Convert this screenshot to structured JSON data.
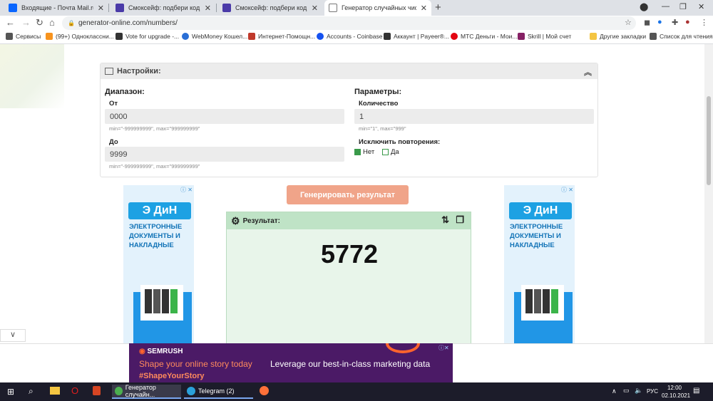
{
  "browser": {
    "tabs": [
      {
        "title": "Входящие - Почта Mail.ru",
        "color": "#0a66ff"
      },
      {
        "title": "Смокcейф: подбери код и полу",
        "color": "#4a3aa8"
      },
      {
        "title": "Смокcейф: подбери код и полу",
        "color": "#4a3aa8"
      },
      {
        "title": "Генератор случайных чисел он",
        "color": "#777777"
      }
    ],
    "new_tab": "+",
    "url": "generator-online.com/numbers/"
  },
  "bookmarks": [
    {
      "label": "Сервисы",
      "color": "#555555"
    },
    {
      "label": "(99+) Одноклассни...",
      "color": "#f7931e"
    },
    {
      "label": "Vote for upgrade -...",
      "color": "#333333"
    },
    {
      "label": "WebMoney Кошел...",
      "color": "#2a6fd6"
    },
    {
      "label": "Интернет-Помощн...",
      "color": "#c0392b"
    },
    {
      "label": "Accounts - Coinbase",
      "color": "#1652f0"
    },
    {
      "label": "Аккаунт | Payeer®...",
      "color": "#333333"
    },
    {
      "label": "МТС Деньги - Мои...",
      "color": "#e30611"
    },
    {
      "label": "Skrill | Мой счет",
      "color": "#862165"
    },
    {
      "label": "Другие закладки",
      "color": "#f4c542"
    },
    {
      "label": "Список для чтения",
      "color": "#555555"
    }
  ],
  "settings": {
    "title": "Настройки:",
    "range_label": "Диапазон:",
    "from_label": "От",
    "from_value": "0000",
    "from_hint": "min=\"-999999999\", max=\"999999999\"",
    "to_label": "До",
    "to_value": "9999",
    "to_hint": "min=\"-999999999\", max=\"999999999\"",
    "params_label": "Параметры:",
    "count_label": "Количество",
    "count_value": "1",
    "count_hint": "min=\"1\", max=\"999\"",
    "exclude_label": "Исключить повторения:",
    "option_no": "Нет",
    "option_yes": "Да",
    "selected": "Нет"
  },
  "generate_button": "Генерировать результат",
  "result": {
    "title": "Результат:",
    "value": "5772"
  },
  "ad_side": {
    "logo": "Э ДиН",
    "text": "ЭЛЕКТРОННЫЕ ДОКУМЕНТЫ И НАКЛАДНЫЕ",
    "info": "ⓘ ✕"
  },
  "banner": {
    "brand": "SEMRUSH",
    "line1": "Shape your online story today",
    "hashtag": "#ShapeYourStory",
    "right": "Leverage our best-in-class marketing data"
  },
  "taskbar": {
    "apps": [
      "Генератор случайн...",
      "Telegram (2)"
    ],
    "lang": "РУС",
    "time": "12:00",
    "date": "02.10.2021"
  },
  "colors": {
    "accent_button": "#f0a489",
    "result_bg": "#e8f5ea",
    "result_header": "#bfe3c6",
    "checkbox_green": "#3a9a4a"
  }
}
